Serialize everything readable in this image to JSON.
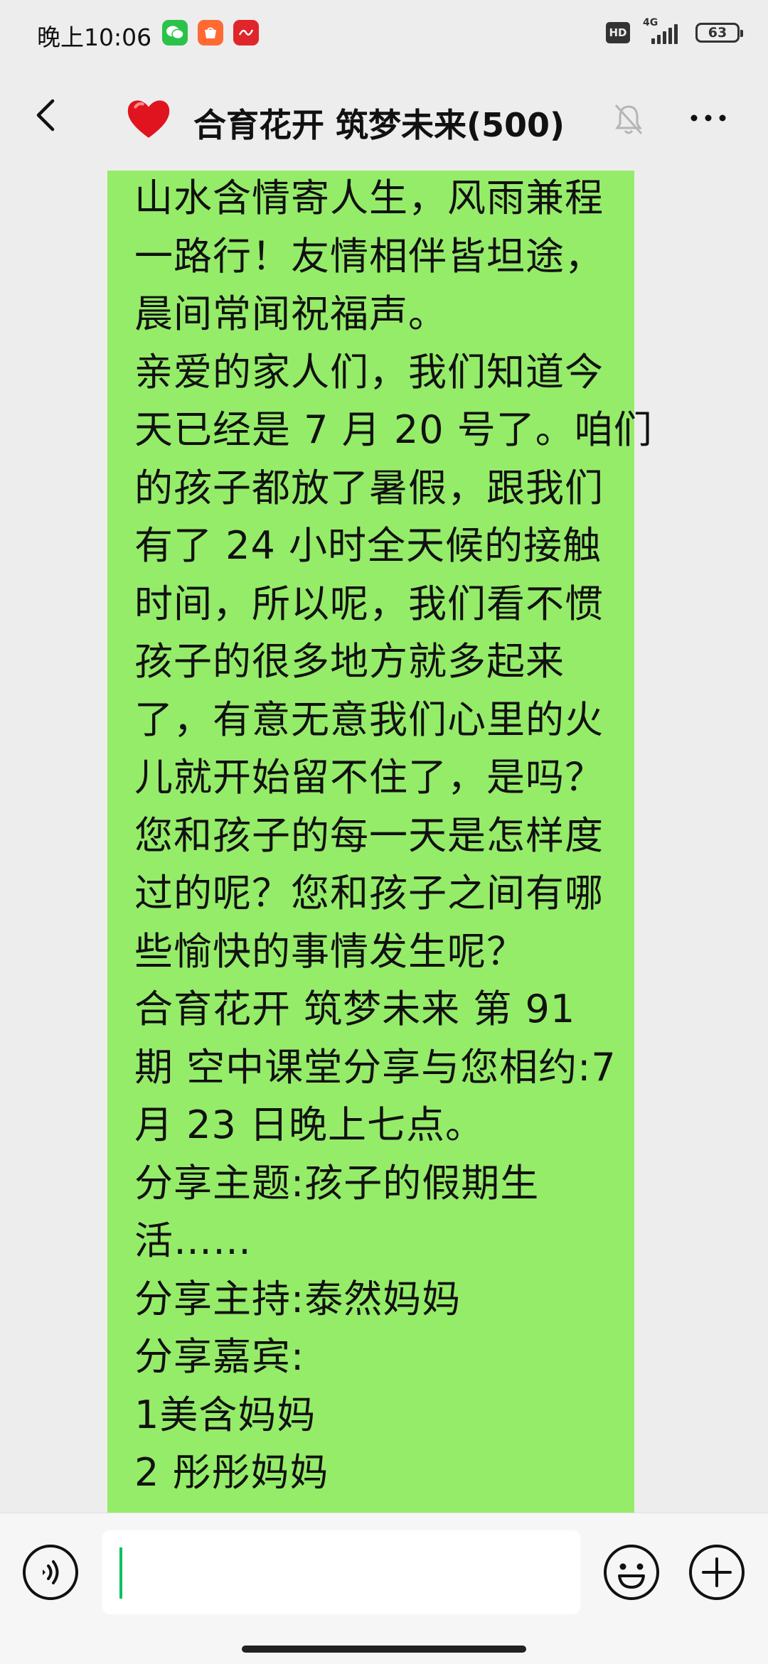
{
  "status_bar": {
    "time": "晚上10:06",
    "hd": "HD",
    "network": "4G",
    "battery": "63",
    "notifications": [
      {
        "icon": "wechat-icon",
        "color": "#2bc24a"
      },
      {
        "icon": "shopping-bag-icon",
        "color": "#ff6a33"
      },
      {
        "icon": "xuexi-app-icon",
        "color": "#e0262a"
      }
    ]
  },
  "header": {
    "title_emoji": "heart-icon",
    "title": "合育花开 筑梦未来(500)"
  },
  "message": {
    "lines": [
      "山水含情寄人生，风雨兼程",
      "一路行！友情相伴皆坦途，",
      "晨间常闻祝福声。",
      "亲爱的家人们，我们知道今",
      "天已经是 7 月 20 号了。咱们",
      "的孩子都放了暑假，跟我们",
      "有了 24 小时全天候的接触",
      "时间，所以呢，我们看不惯",
      "孩子的很多地方就多起来",
      "了，有意无意我们心里的火",
      "儿就开始留不住了，是吗？",
      "您和孩子的每一天是怎样度",
      "过的呢？您和孩子之间有哪",
      "些愉快的事情发生呢？",
      "合育花开 筑梦未来 第 91",
      "期 空中课堂分享与您相约:7",
      "月 23 日晚上七点。",
      "分享主题:孩子的假期生",
      "活……",
      "分享主持:泰然妈妈",
      "分享嘉宾:",
      "1美含妈妈",
      "2 彤彤妈妈"
    ]
  },
  "input": {
    "value": ""
  },
  "colors": {
    "bubble": "#95ec69",
    "background": "#ededed",
    "caret": "#07c160"
  }
}
